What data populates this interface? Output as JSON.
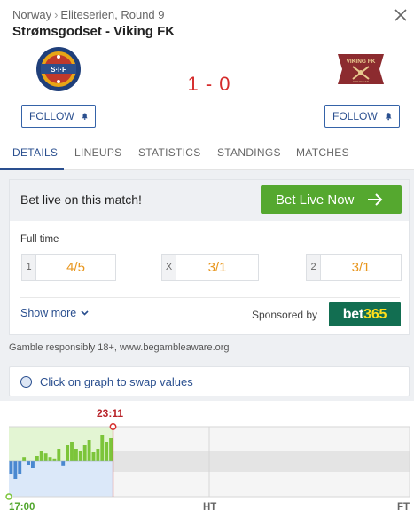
{
  "breadcrumb": {
    "country": "Norway",
    "separator": "›",
    "competition": "Eliteserien, Round 9"
  },
  "match": {
    "title": "Strømsgodset - Viking FK",
    "score": "1 - 0",
    "home_team": "Strømsgodset",
    "away_team": "Viking FK"
  },
  "follow": {
    "home_label": "FOLLOW",
    "away_label": "FOLLOW"
  },
  "tabs": [
    "DETAILS",
    "LINEUPS",
    "STATISTICS",
    "STANDINGS",
    "MATCHES"
  ],
  "active_tab": "DETAILS",
  "betting": {
    "prompt": "Bet live on this match!",
    "live_button": "Bet Live Now",
    "period": "Full time",
    "odds": [
      {
        "label": "1",
        "value": "4/5"
      },
      {
        "label": "X",
        "value": "3/1"
      },
      {
        "label": "2",
        "value": "3/1"
      }
    ],
    "show_more": "Show more",
    "sponsored_by": "Sponsored by",
    "sponsor": {
      "part1": "bet",
      "part2": "365"
    }
  },
  "disclaimer": "Gamble responsibly 18+, www.begambleaware.org",
  "graph": {
    "swap_hint": "Click on graph to swap values",
    "current_time": "23:11",
    "start_label": "17:00",
    "half_label": "HT",
    "end_label": "FT",
    "progress": 0.26,
    "bars": [
      -0.35,
      -0.5,
      -0.35,
      0.12,
      -0.1,
      -0.2,
      0.15,
      0.3,
      0.22,
      0.12,
      0.08,
      0.35,
      -0.12,
      0.45,
      0.55,
      0.35,
      0.3,
      0.45,
      0.6,
      0.25,
      0.35,
      0.75,
      0.55,
      0.65
    ],
    "colors": {
      "home": "#7cc53a",
      "away": "#4a88d0",
      "home_bg": "#e3f5d3",
      "away_bg": "#dbe8f9",
      "marker": "#d52b2b"
    }
  },
  "colors": {
    "accent": "#2a4f8f",
    "score": "#d52b2b",
    "odds": "#e8961d",
    "live_button": "#55a82f",
    "sponsor_bg": "#126e51"
  }
}
